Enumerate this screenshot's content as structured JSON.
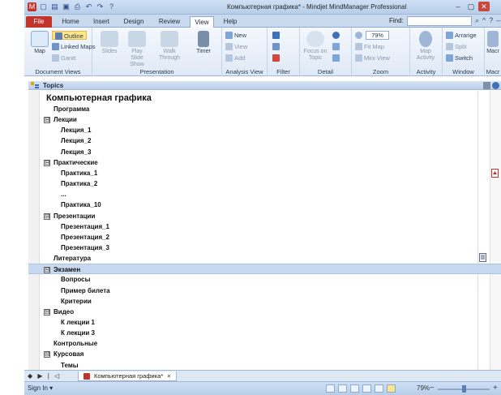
{
  "window": {
    "title": "Компьютерная графика* - Mindjet MindManager Professional",
    "colors": {
      "file_tab": "#c0342b",
      "selection": "#c6d9f1",
      "ribbon": "#dfe9f6",
      "highlight": "#ffe58a"
    }
  },
  "quick_access": [
    "app-icon",
    "new-icon",
    "open-icon",
    "save-icon",
    "print-icon",
    "undo-icon",
    "redo-icon",
    "help-icon"
  ],
  "tabs": [
    "File",
    "Home",
    "Insert",
    "Design",
    "Review",
    "View",
    "Help"
  ],
  "active_tab": "View",
  "find": {
    "label": "Find:",
    "value": ""
  },
  "ribbon": {
    "groups": {
      "document_views": "Document Views",
      "presentation": "Presentation",
      "analysis_view": "Analysis View",
      "filter": "Filter",
      "detail": "Detail",
      "zoom": "Zoom",
      "activity": "Activity",
      "window": "Window",
      "macros": "Macr"
    },
    "map": "Map",
    "outline": "Outline",
    "linked_maps": "Linked Maps",
    "gantt": "Gantt",
    "slides": "Slides",
    "play_slide_show": "Play Slide Show",
    "walk_through": "Walk Through",
    "timer": "Timer",
    "new": "New",
    "view": "View",
    "add": "Add",
    "focus_on_topic": "Focus on Topic",
    "zoom_value": "79%",
    "fit_map": "Fit Map",
    "mini_view": "Mini View",
    "map_activity": "Map Activity",
    "arrange": "Arrange",
    "split": "Split",
    "switch": "Switch",
    "macro": "Macr"
  },
  "topics_header": "Topics",
  "outline": {
    "root": "Компьютерная графика",
    "rows": [
      {
        "text": "Программа",
        "level": 1,
        "toggle": ""
      },
      {
        "text": "Лекции",
        "level": 1,
        "toggle": "⊟"
      },
      {
        "text": "Лекция_1",
        "level": 2,
        "toggle": ""
      },
      {
        "text": "Лекция_2",
        "level": 2,
        "toggle": ""
      },
      {
        "text": "Лекция_3",
        "level": 2,
        "toggle": ""
      },
      {
        "text": "Практические",
        "level": 1,
        "toggle": "⊟"
      },
      {
        "text": "Практика_1",
        "level": 2,
        "toggle": ""
      },
      {
        "text": "Практика_2",
        "level": 2,
        "toggle": ""
      },
      {
        "text": "...",
        "level": 2,
        "toggle": ""
      },
      {
        "text": "Практика_10",
        "level": 2,
        "toggle": ""
      },
      {
        "text": "Презентации",
        "level": 1,
        "toggle": "⊟"
      },
      {
        "text": "Презентация_1",
        "level": 2,
        "toggle": ""
      },
      {
        "text": "Презентация_2",
        "level": 2,
        "toggle": ""
      },
      {
        "text": "Презентация_3",
        "level": 2,
        "toggle": ""
      },
      {
        "text": "Литература",
        "level": 1,
        "toggle": ""
      },
      {
        "text": "Экзамен",
        "level": 1,
        "toggle": "⊟"
      },
      {
        "text": "Вопросы",
        "level": 2,
        "toggle": ""
      },
      {
        "text": "Пример билета",
        "level": 2,
        "toggle": ""
      },
      {
        "text": "Критерии",
        "level": 2,
        "toggle": ""
      },
      {
        "text": "Видео",
        "level": 1,
        "toggle": "⊟"
      },
      {
        "text": "К лекции 1",
        "level": 2,
        "toggle": ""
      },
      {
        "text": "К лекции 3",
        "level": 2,
        "toggle": ""
      },
      {
        "text": "Контрольные",
        "level": 1,
        "toggle": ""
      },
      {
        "text": "Курсовая",
        "level": 1,
        "toggle": "⊟"
      },
      {
        "text": "Темы",
        "level": 2,
        "toggle": ""
      }
    ],
    "selected_row": "Экзамен"
  },
  "doc_tab": {
    "label": "Компьютерная графика*",
    "close": "×",
    "nav": "◆ ▶ | ◁"
  },
  "status": {
    "sign_in": "Sign In ▾",
    "zoom": "79%",
    "zoom_minus": "−",
    "zoom_plus": "+"
  }
}
